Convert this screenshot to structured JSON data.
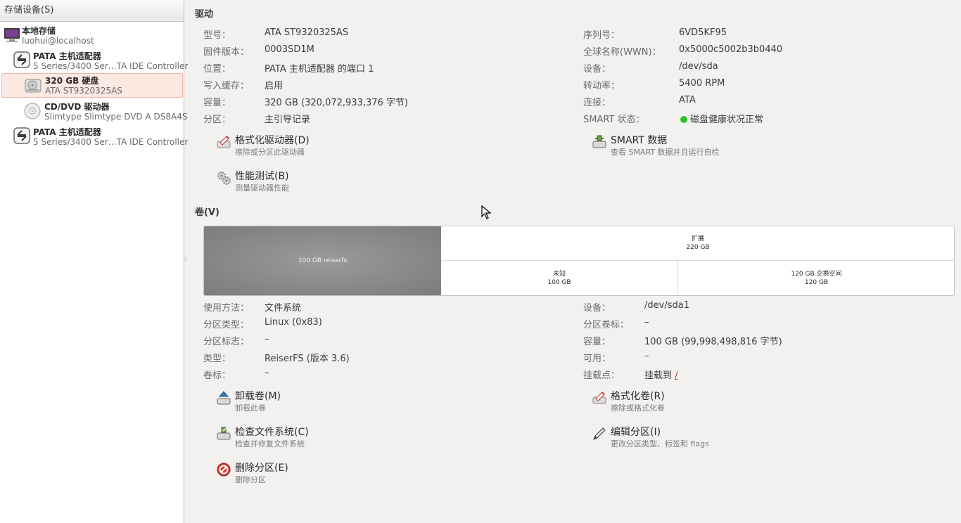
{
  "sidebar": {
    "header": "存储设备(S)",
    "items": [
      {
        "name": "本地存储",
        "sub": "luohui@localhost",
        "icon": "computer-icon"
      },
      {
        "name": "PATA 主机适配器",
        "sub": "5 Series/3400 Ser…TA IDE Controller",
        "icon": "controller-icon"
      },
      {
        "name": "320 GB 硬盘",
        "sub": "ATA ST9320325AS",
        "icon": "harddisk-icon",
        "selected": true
      },
      {
        "name": "CD/DVD 驱动器",
        "sub": "Slimtype Slimtype DVD A  DS8A4S",
        "icon": "optical-disc-icon"
      },
      {
        "name": "PATA 主机适配器",
        "sub": "5 Series/3400 Ser…TA IDE Controller",
        "icon": "controller-icon"
      }
    ]
  },
  "drive": {
    "title": "驱动",
    "left": [
      {
        "label": "型号：",
        "value": "ATA ST9320325AS"
      },
      {
        "label": "固件版本：",
        "value": "0003SD1M"
      },
      {
        "label": "位置：",
        "value": "PATA 主机适配器 的端口 1"
      },
      {
        "label": "写入缓存：",
        "value": "启用"
      },
      {
        "label": "容量：",
        "value": "320 GB (320,072,933,376 字节)"
      },
      {
        "label": "分区：",
        "value": "主引导记录"
      }
    ],
    "right": [
      {
        "label": "序列号：",
        "value": "6VD5KF95"
      },
      {
        "label": "全球名称(WWN)：",
        "value": "0x5000c5002b3b0440"
      },
      {
        "label": "设备：",
        "value": "/dev/sda"
      },
      {
        "label": "转动率：",
        "value": "5400 RPM"
      },
      {
        "label": "连接：",
        "value": "ATA"
      },
      {
        "label": "SMART 状态：",
        "value": "磁盘健康状况正常",
        "status_color": "#2ec427"
      }
    ],
    "actions": [
      {
        "title": "格式化驱动器(D)",
        "sub": "擦除或分区此驱动器",
        "icon": "format-drive-icon"
      },
      {
        "title": "SMART 数据",
        "sub": "查看 SMART 数据并且运行自检",
        "icon": "smart-data-icon"
      },
      {
        "title": "性能测试(B)",
        "sub": "测量驱动器性能",
        "icon": "benchmark-icon"
      }
    ]
  },
  "volumes": {
    "title": "卷(V)",
    "segments": [
      {
        "line1": "100 GB reiserfs",
        "line2": ""
      },
      {
        "line1": "扩展",
        "line2": "220 GB"
      },
      {
        "line1": "未知",
        "line2": "100 GB"
      },
      {
        "line1": "120 GB 交换空间",
        "line2": "120 GB"
      }
    ],
    "left": [
      {
        "label": "使用方法：",
        "value": "文件系统"
      },
      {
        "label": "分区类型：",
        "value": "Linux (0x83)"
      },
      {
        "label": "分区标志：",
        "value": "–"
      },
      {
        "label": "类型：",
        "value": "ReiserFS (版本 3.6)"
      },
      {
        "label": "卷标：",
        "value": "–"
      }
    ],
    "right": [
      {
        "label": "设备：",
        "value": "/dev/sda1"
      },
      {
        "label": "分区卷标：",
        "value": "–"
      },
      {
        "label": "容量：",
        "value": "100 GB (99,998,498,816 字节)"
      },
      {
        "label": "可用：",
        "value": "–"
      },
      {
        "label": "挂载点：",
        "value": "挂载到 ",
        "link": "/"
      }
    ],
    "actions": [
      {
        "title": "卸载卷(M)",
        "sub": "卸载此卷",
        "icon": "unmount-icon"
      },
      {
        "title": "格式化卷(R)",
        "sub": "擦除或格式化卷",
        "icon": "format-volume-icon"
      },
      {
        "title": "检查文件系统(C)",
        "sub": "检查并修复文件系统",
        "icon": "check-filesystem-icon"
      },
      {
        "title": "编辑分区(I)",
        "sub": "更改分区类型、标签和 flags",
        "icon": "edit-partition-icon"
      },
      {
        "title": "删除分区(E)",
        "sub": "删除分区",
        "icon": "delete-partition-icon"
      }
    ]
  }
}
